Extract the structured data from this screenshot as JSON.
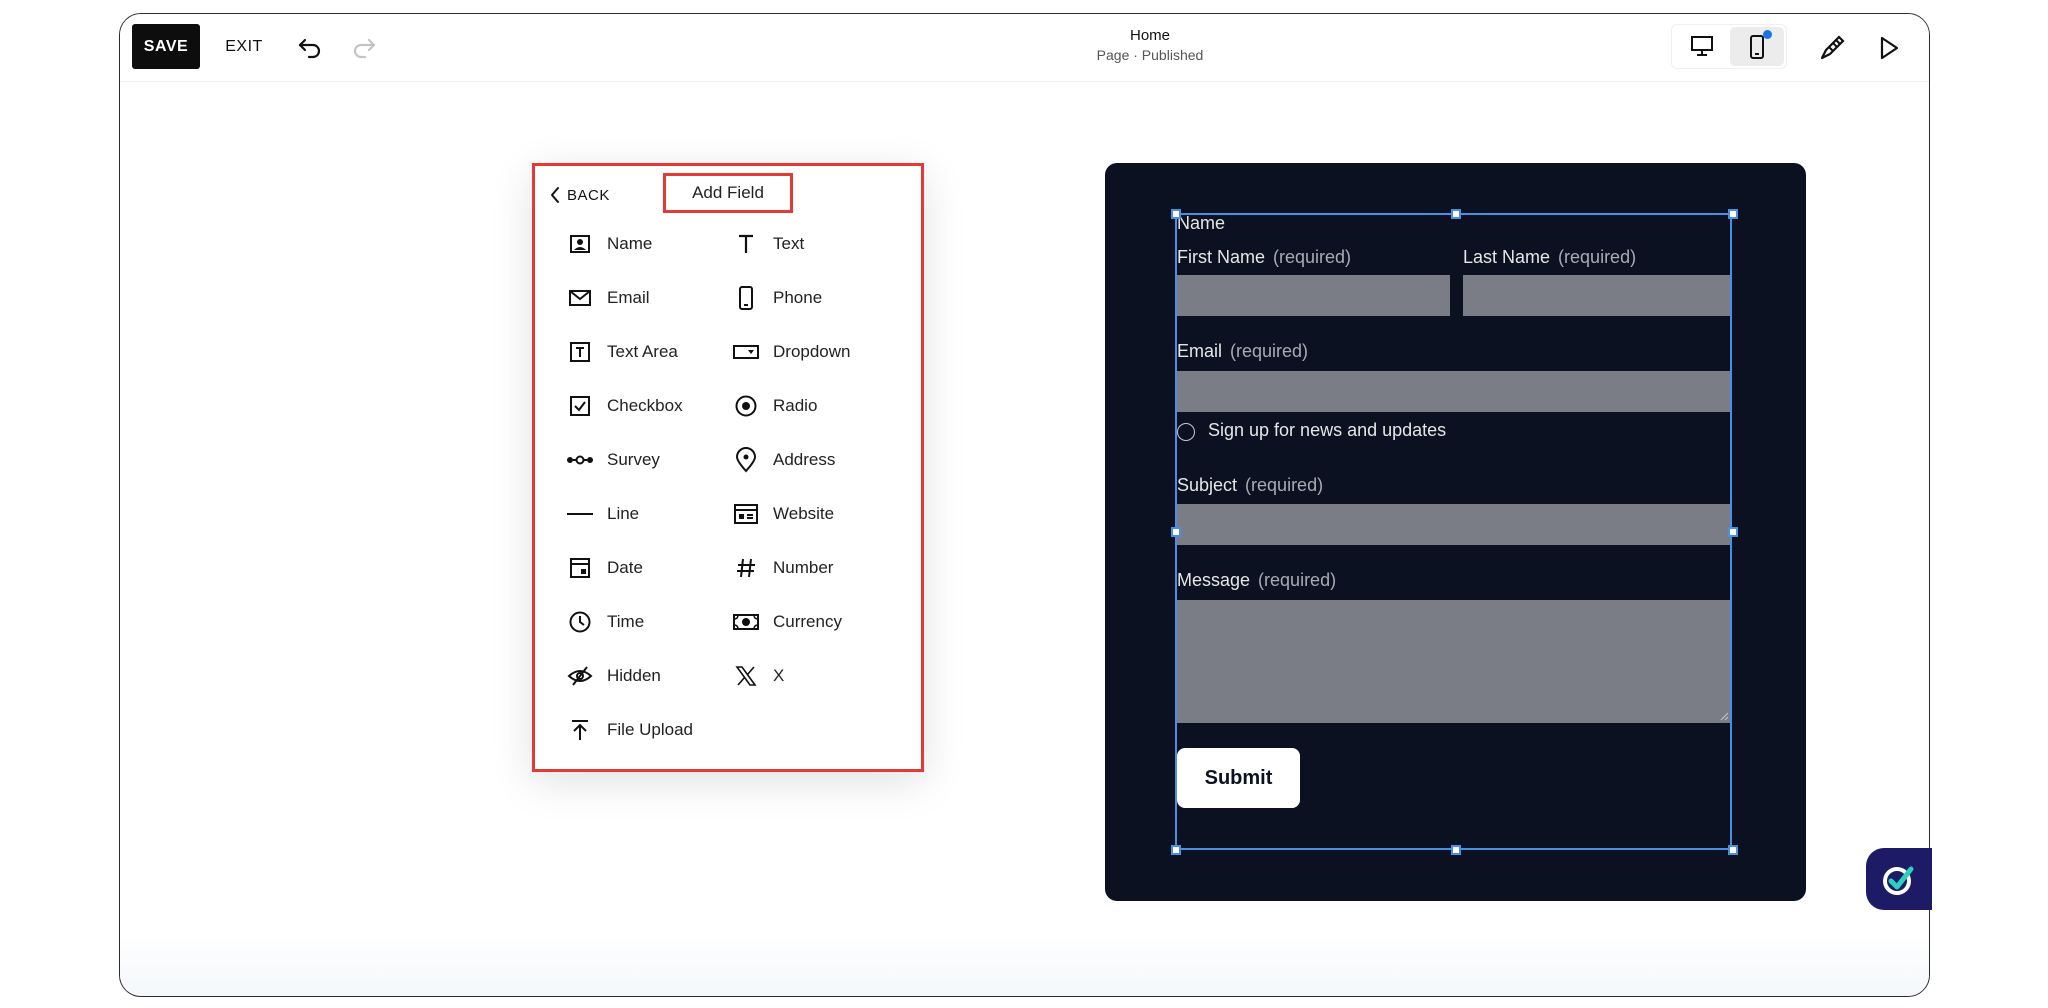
{
  "toolbar": {
    "save_label": "SAVE",
    "exit_label": "EXIT",
    "page_title": "Home",
    "page_status": "Page · Published"
  },
  "panel": {
    "back_label": "BACK",
    "title": "Add Field",
    "fields": [
      {
        "label": "Name",
        "icon": "name-card-icon"
      },
      {
        "label": "Text",
        "icon": "text-t-icon"
      },
      {
        "label": "Email",
        "icon": "envelope-icon"
      },
      {
        "label": "Phone",
        "icon": "phone-icon"
      },
      {
        "label": "Text Area",
        "icon": "text-area-icon"
      },
      {
        "label": "Dropdown",
        "icon": "dropdown-icon"
      },
      {
        "label": "Checkbox",
        "icon": "checkbox-icon"
      },
      {
        "label": "Radio",
        "icon": "radio-icon"
      },
      {
        "label": "Survey",
        "icon": "survey-icon"
      },
      {
        "label": "Address",
        "icon": "map-pin-icon"
      },
      {
        "label": "Line",
        "icon": "line-icon"
      },
      {
        "label": "Website",
        "icon": "website-icon"
      },
      {
        "label": "Date",
        "icon": "calendar-icon"
      },
      {
        "label": "Number",
        "icon": "hash-icon"
      },
      {
        "label": "Time",
        "icon": "clock-icon"
      },
      {
        "label": "Currency",
        "icon": "currency-icon"
      },
      {
        "label": "Hidden",
        "icon": "eye-off-icon"
      },
      {
        "label": "X",
        "icon": "x-logo-icon"
      },
      {
        "label": "File Upload",
        "icon": "upload-icon"
      }
    ]
  },
  "form": {
    "name_heading": "Name",
    "first_name_label": "First Name",
    "last_name_label": "Last Name",
    "email_label": "Email",
    "newsletter_label": "Sign up for news and updates",
    "subject_label": "Subject",
    "message_label": "Message",
    "required_text": "(required)",
    "submit_label": "Submit"
  },
  "colors": {
    "form_background": "#0b1120",
    "input_fill": "#7a7c86",
    "selection": "#4a90e2",
    "highlight": "#e53935",
    "help_bubble": "#1d1a66",
    "notification_dot": "#1a73e8"
  }
}
